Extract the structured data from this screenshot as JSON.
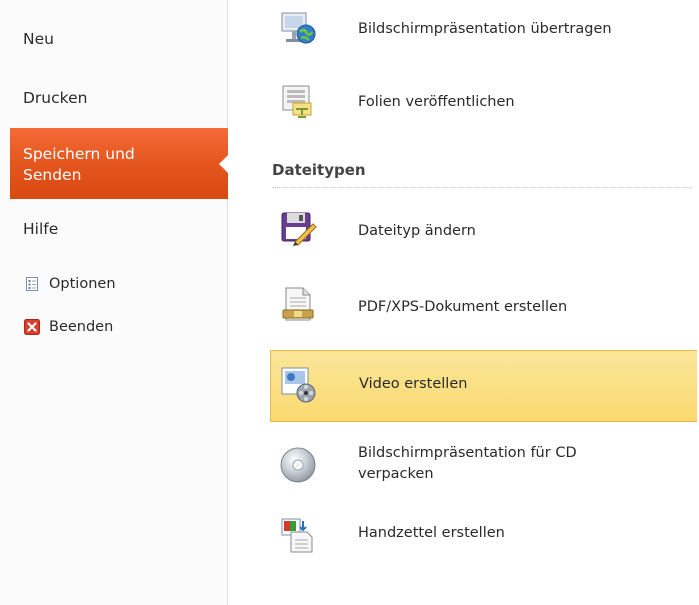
{
  "sidebar": {
    "items": [
      {
        "label": "Neu"
      },
      {
        "label": "Drucken"
      },
      {
        "label_line1": "Speichern und",
        "label_line2": "Senden"
      },
      {
        "label": "Hilfe"
      }
    ],
    "sub_items": [
      {
        "label": "Optionen",
        "icon": "options-document-icon"
      },
      {
        "label": "Beenden",
        "icon": "exit-red-x-icon"
      }
    ],
    "selected_color": "#e4541d"
  },
  "content": {
    "top_options": [
      {
        "label": "Bildschirmpräsentation übertragen",
        "icon": "broadcast-globe-icon"
      },
      {
        "label": "Folien veröffentlichen",
        "icon": "publish-slides-icon"
      }
    ],
    "section_title": "Dateitypen",
    "file_type_options": [
      {
        "label": "Dateityp ändern",
        "icon": "save-disk-pencil-icon"
      },
      {
        "label": "PDF/XPS-Dokument erstellen",
        "icon": "pdf-document-icon"
      },
      {
        "label": "Video erstellen",
        "icon": "video-film-reel-icon",
        "highlighted": true
      },
      {
        "label_line1": "Bildschirmpräsentation für CD",
        "label_line2": "verpacken",
        "icon": "cd-disc-icon"
      },
      {
        "label": "Handzettel erstellen",
        "icon": "handout-document-icon"
      }
    ],
    "highlight_color": "#fad96f"
  }
}
